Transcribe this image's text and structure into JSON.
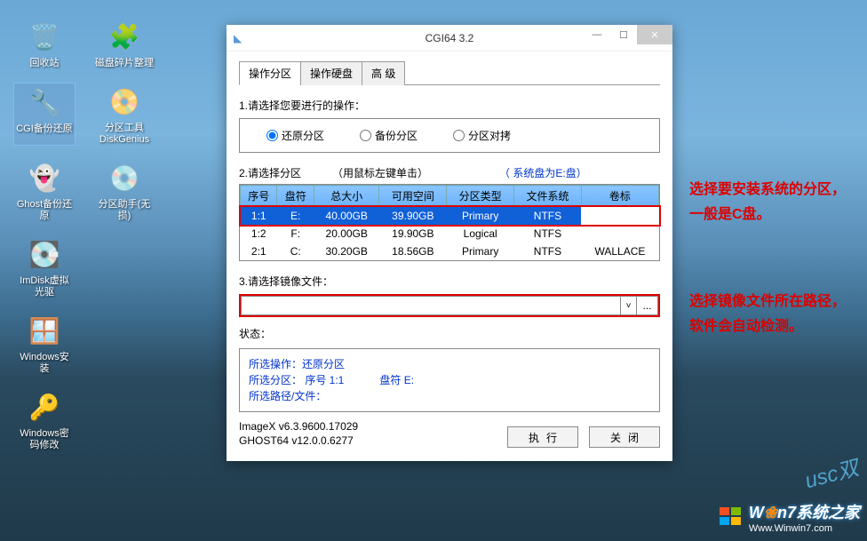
{
  "desktop": {
    "icons": [
      {
        "label": "回收站",
        "glyph": "🗑️"
      },
      {
        "label": "磁盘碎片整理",
        "glyph": "🧩"
      },
      {
        "label": "CGI备份还原",
        "glyph": "🔧"
      },
      {
        "label": "分区工具\nDiskGenius",
        "glyph": "📀"
      },
      {
        "label": "Ghost备份还\n原",
        "glyph": "👻"
      },
      {
        "label": "分区助手(无\n损)",
        "glyph": "💿"
      },
      {
        "label": "ImDisk虚拟\n光驱",
        "glyph": "💽"
      },
      {
        "label": "Windows安\n装",
        "glyph": "🪟"
      },
      {
        "label": "Windows密\n码修改",
        "glyph": "🔑"
      }
    ]
  },
  "window": {
    "title": "CGI64 3.2",
    "tabs": [
      "操作分区",
      "操作硬盘",
      "高 级"
    ],
    "section1": {
      "title": "1.请选择您要进行的操作：",
      "options": [
        "还原分区",
        "备份分区",
        "分区对拷"
      ]
    },
    "section2": {
      "title": "2.请选择分区",
      "hint": "（用鼠标左键单击）",
      "system_disk": "（ 系统盘为E:盘）",
      "headers": [
        "序号",
        "盘符",
        "总大小",
        "可用空间",
        "分区类型",
        "文件系统",
        "卷标"
      ],
      "rows": [
        {
          "num": "1:1",
          "drive": "E:",
          "total": "40.00GB",
          "free": "39.90GB",
          "ptype": "Primary",
          "fs": "NTFS",
          "vol": ""
        },
        {
          "num": "1:2",
          "drive": "F:",
          "total": "20.00GB",
          "free": "19.90GB",
          "ptype": "Logical",
          "fs": "NTFS",
          "vol": ""
        },
        {
          "num": "2:1",
          "drive": "C:",
          "total": "30.20GB",
          "free": "18.56GB",
          "ptype": "Primary",
          "fs": "NTFS",
          "vol": "WALLACE"
        }
      ]
    },
    "section3": {
      "title": "3.请选择镜像文件：",
      "value": "",
      "browse": "..."
    },
    "status": {
      "label": "状态：",
      "op": "所选操作：还原分区",
      "part": "所选分区： 序号 1:1",
      "drive": "盘符 E:",
      "path": "所选路径/文件："
    },
    "version": {
      "imagex": "ImageX v6.3.9600.17029",
      "ghost": "GHOST64 v12.0.0.6277"
    },
    "buttons": {
      "exec": "执行",
      "close": "关闭"
    }
  },
  "annotations": {
    "a1": "选择要安装系统的分区，\n一般是C盘。",
    "a2": "选择镜像文件所在路径，\n软件会自动检测。"
  },
  "watermark": {
    "text1": "W",
    "text2": "n7系统之家",
    "url": "Www.Winwin7.com",
    "curve": "usc双"
  }
}
